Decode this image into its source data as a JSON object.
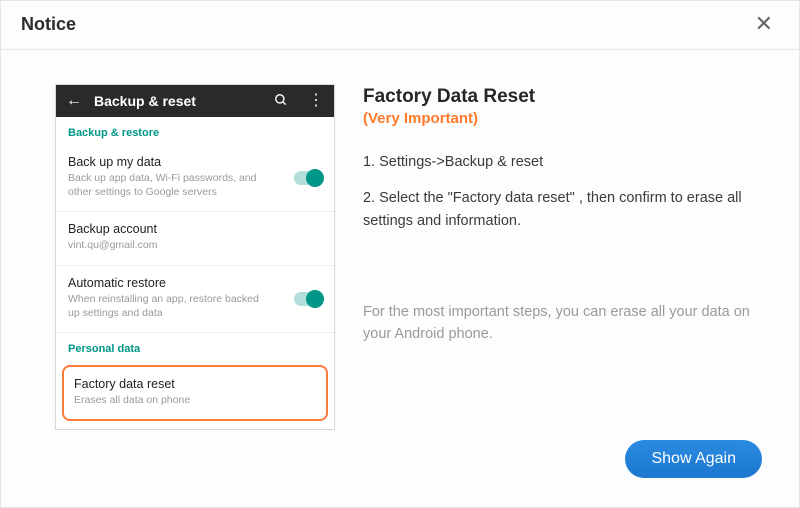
{
  "dialog": {
    "title": "Notice"
  },
  "phone": {
    "header_title": "Backup & reset",
    "section_backup": "Backup & restore",
    "backup_data": {
      "title": "Back up my data",
      "sub": "Back up app data, Wi-Fi passwords, and other settings to Google servers"
    },
    "backup_account": {
      "title": "Backup account",
      "sub": "vint.qu@gmail.com"
    },
    "auto_restore": {
      "title": "Automatic restore",
      "sub": "When reinstalling an app, restore backed up settings and data"
    },
    "section_personal": "Personal data",
    "factory_reset": {
      "title": "Factory data reset",
      "sub": "Erases all data on phone"
    }
  },
  "info": {
    "title": "Factory Data Reset",
    "important": "(Very Important)",
    "step1": "1. Settings->Backup & reset",
    "step2": "2. Select the \"Factory data reset\" , then confirm to erase all settings and information.",
    "note": "For the most important steps, you can erase all your data on your Android phone."
  },
  "buttons": {
    "show_again": "Show Again"
  }
}
